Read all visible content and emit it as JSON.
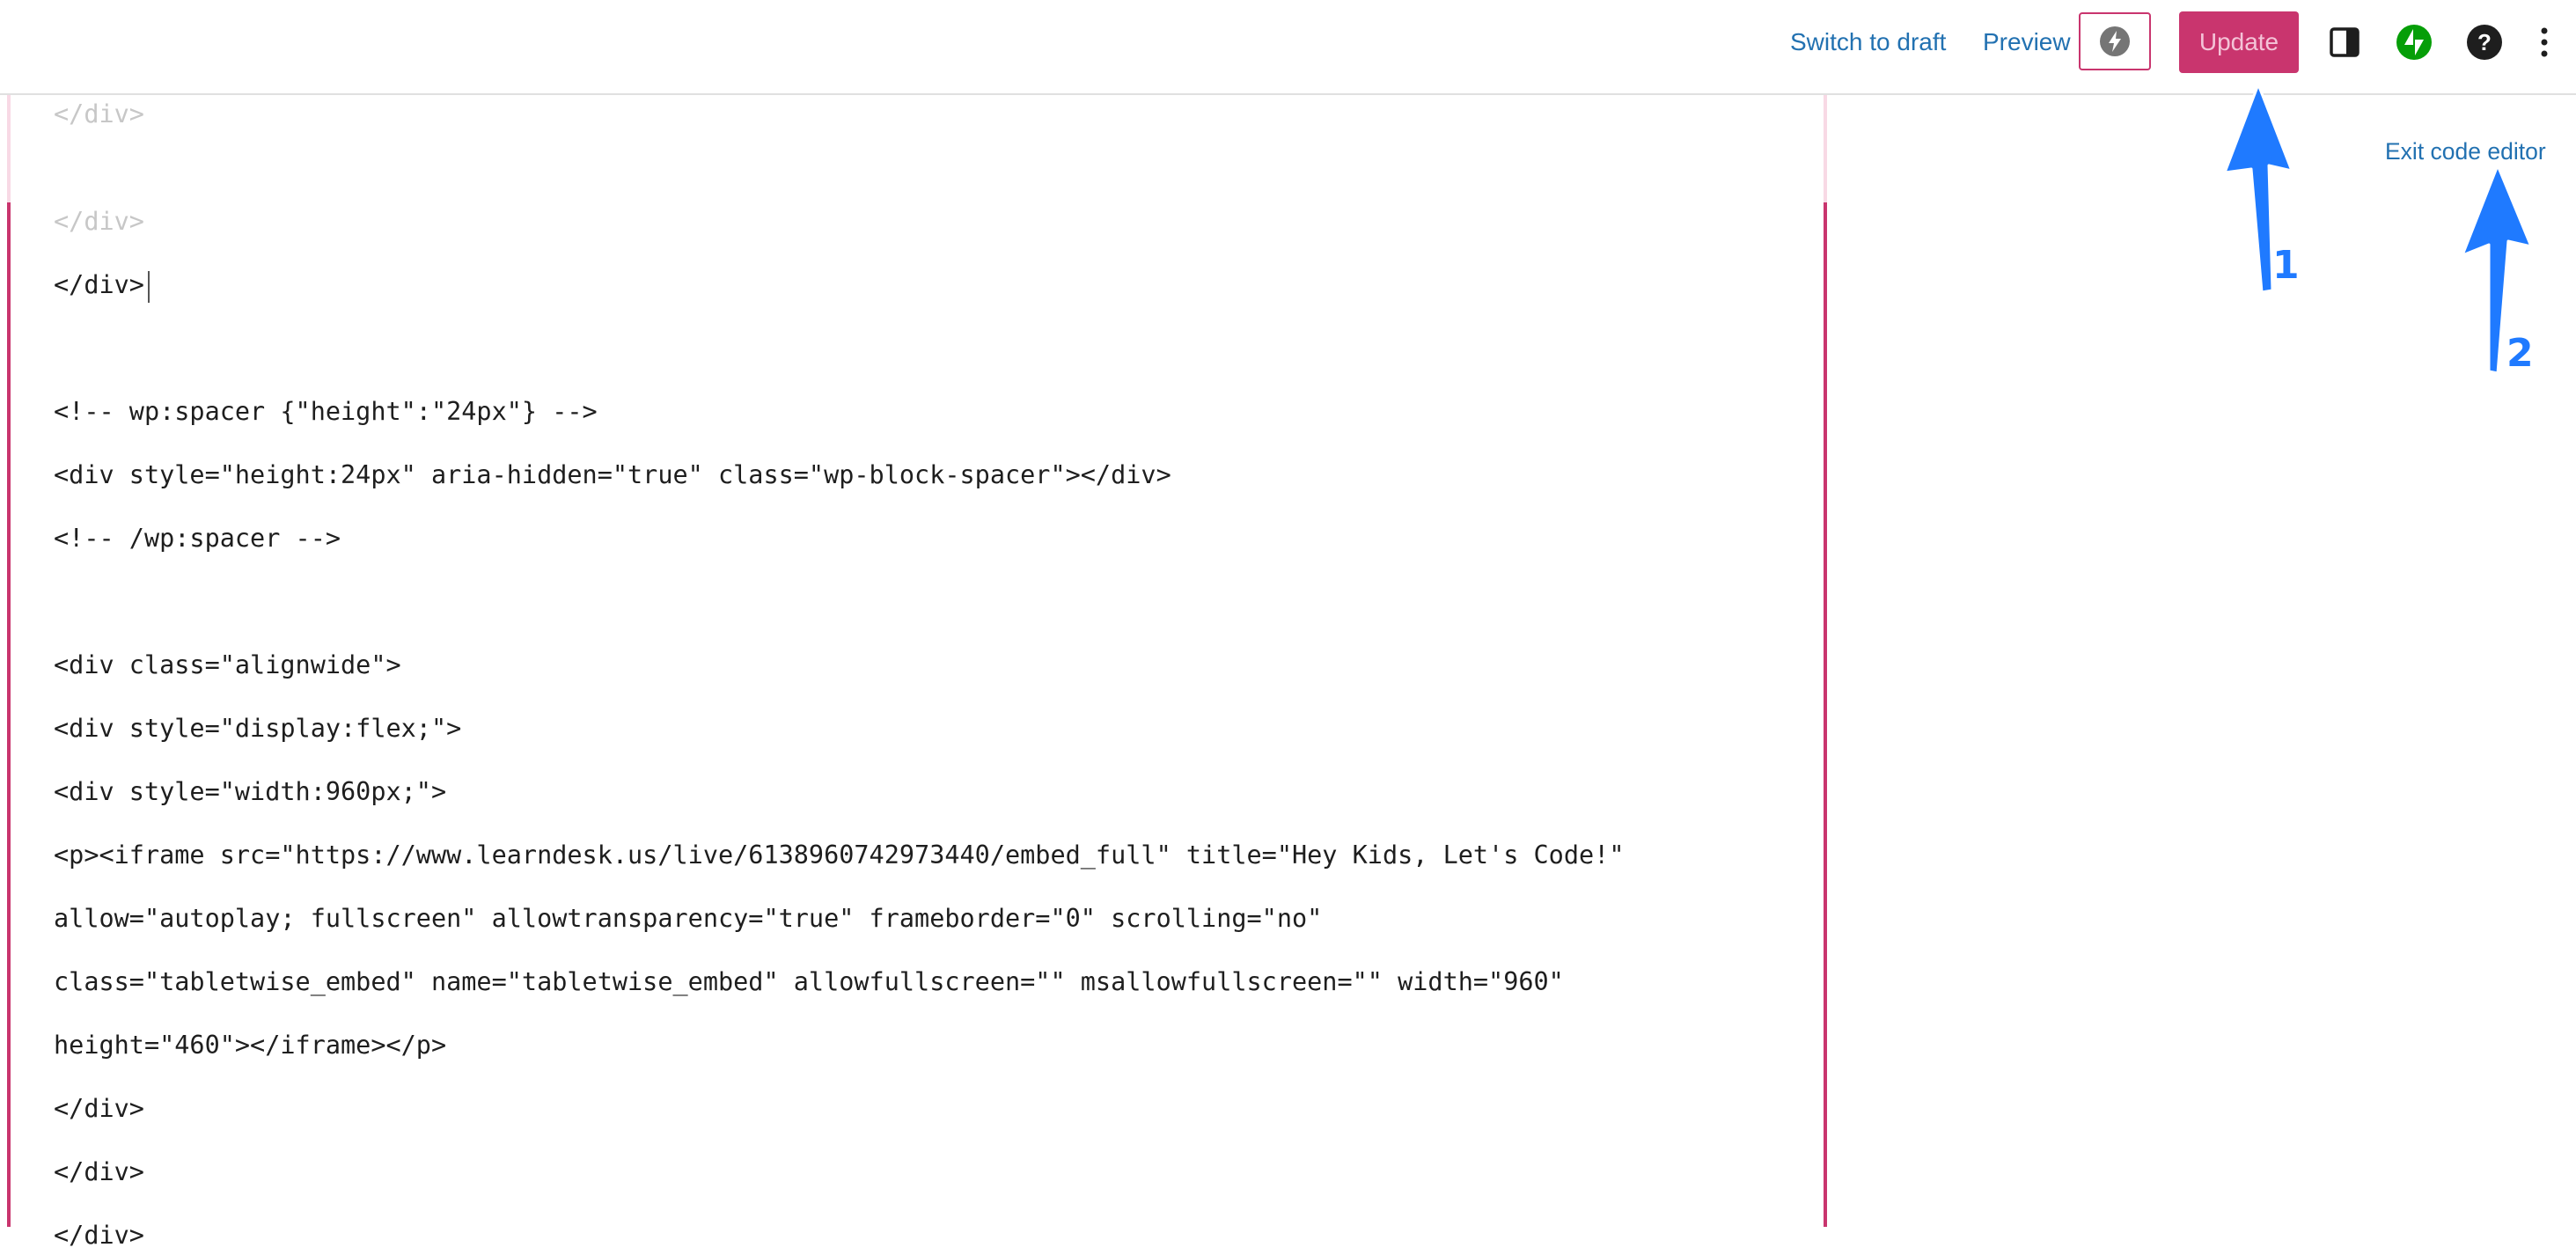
{
  "toolbar": {
    "switch_to_draft": "Switch to draft",
    "preview": "Preview",
    "boost_icon": "lightning-bolt-icon",
    "update": "Update",
    "settings_icon": "sidebar-toggle-icon",
    "jetpack_icon": "jetpack-icon",
    "help_icon": "help-icon",
    "more_icon": "vertical-ellipsis-icon"
  },
  "sidebar": {
    "exit_code_editor": "Exit code editor"
  },
  "code_lines": [
    "</div>",
    "</div>",
    "</div>",
    "",
    "<!-- wp:spacer {\"height\":\"24px\"} -->",
    "<div style=\"height:24px\" aria-hidden=\"true\" class=\"wp-block-spacer\"></div>",
    "<!-- /wp:spacer -->",
    "",
    "<div class=\"alignwide\">",
    "<div style=\"display:flex;\">",
    "<div style=\"width:960px;\">",
    "<p><iframe src=\"https://www.learndesk.us/live/6138960742973440/embed_full\" title=\"Hey Kids, Let's Code!\"",
    "allow=\"autoplay; fullscreen\" allowtransparency=\"true\" frameborder=\"0\" scrolling=\"no\"",
    "class=\"tabletwise_embed\" name=\"tabletwise_embed\" allowfullscreen=\"\" msallowfullscreen=\"\" width=\"960\"",
    "height=\"460\"></iframe></p>",
    "</div>",
    "</div>",
    "</div>"
  ],
  "annotations": {
    "marker_1": "1",
    "marker_2": "2"
  },
  "colors": {
    "accent": "#c9356e",
    "link": "#2271b1",
    "annotation": "#1f7aff",
    "jetpack": "#069e08"
  }
}
